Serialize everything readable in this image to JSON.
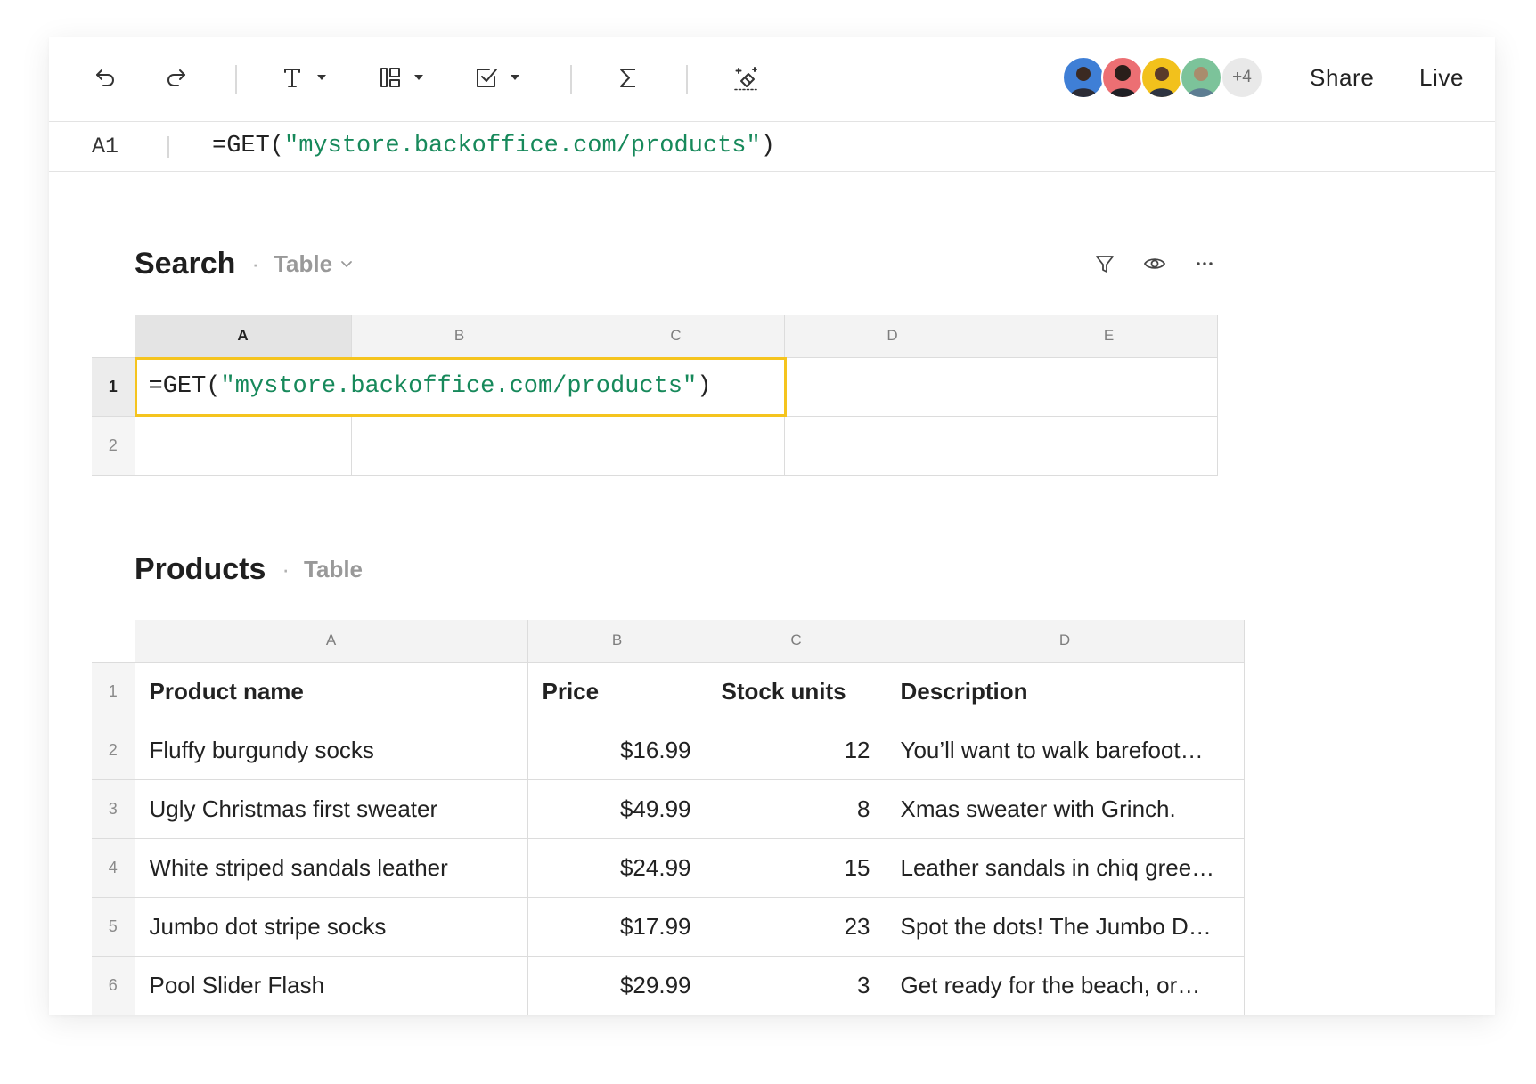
{
  "colors": {
    "selection_border": "#f5c41e",
    "string_literal": "#17895b",
    "text_primary": "#222222",
    "text_muted": "#999999"
  },
  "toolbar": {
    "icons": [
      "undo-icon",
      "redo-icon",
      "text-format-icon",
      "layout-icon",
      "checkbox-icon",
      "sigma-icon",
      "magic-eraser-icon"
    ],
    "collaborators": [
      {
        "color": "#3f7fd6"
      },
      {
        "color": "#ec6f73"
      },
      {
        "color": "#f2c11c"
      },
      {
        "color": "#7cc39a"
      }
    ],
    "more_collaborators": "+4",
    "share_label": "Share",
    "live_label": "Live"
  },
  "formula_bar": {
    "cell_ref": "A1",
    "formula": {
      "function": "=GET(",
      "argument": "\"mystore.backoffice.com/products\"",
      "close": ")"
    }
  },
  "search": {
    "title": "Search",
    "separator": "·",
    "view_label": "Table",
    "actions": [
      "filter-icon",
      "eye-icon",
      "more-icon"
    ],
    "columns": [
      "A",
      "B",
      "C",
      "D",
      "E"
    ],
    "row_numbers": [
      "1",
      "2"
    ],
    "cell_a1": {
      "function": "=GET(",
      "argument": "\"mystore.backoffice.com/products\"",
      "close": ")"
    }
  },
  "products": {
    "title": "Products",
    "separator": "·",
    "view_label": "Table",
    "columns": [
      "A",
      "B",
      "C",
      "D"
    ],
    "row_numbers": [
      "1",
      "2",
      "3",
      "4",
      "5",
      "6"
    ],
    "header": {
      "name": "Product name",
      "price": "Price",
      "stock": "Stock units",
      "description": "Description"
    },
    "rows": [
      {
        "name": "Fluffy burgundy socks",
        "price": "$16.99",
        "stock": "12",
        "description": "You’ll want to walk barefoot…"
      },
      {
        "name": "Ugly Christmas first sweater",
        "price": "$49.99",
        "stock": "8",
        "description": "Xmas sweater with Grinch."
      },
      {
        "name": "White striped sandals leather",
        "price": "$24.99",
        "stock": "15",
        "description": "Leather sandals in chiq gree…"
      },
      {
        "name": "Jumbo dot stripe socks",
        "price": "$17.99",
        "stock": "23",
        "description": "Spot the dots! The Jumbo D…"
      },
      {
        "name": "Pool Slider Flash",
        "price": "$29.99",
        "stock": "3",
        "description": "Get ready for the beach, or…"
      }
    ]
  }
}
